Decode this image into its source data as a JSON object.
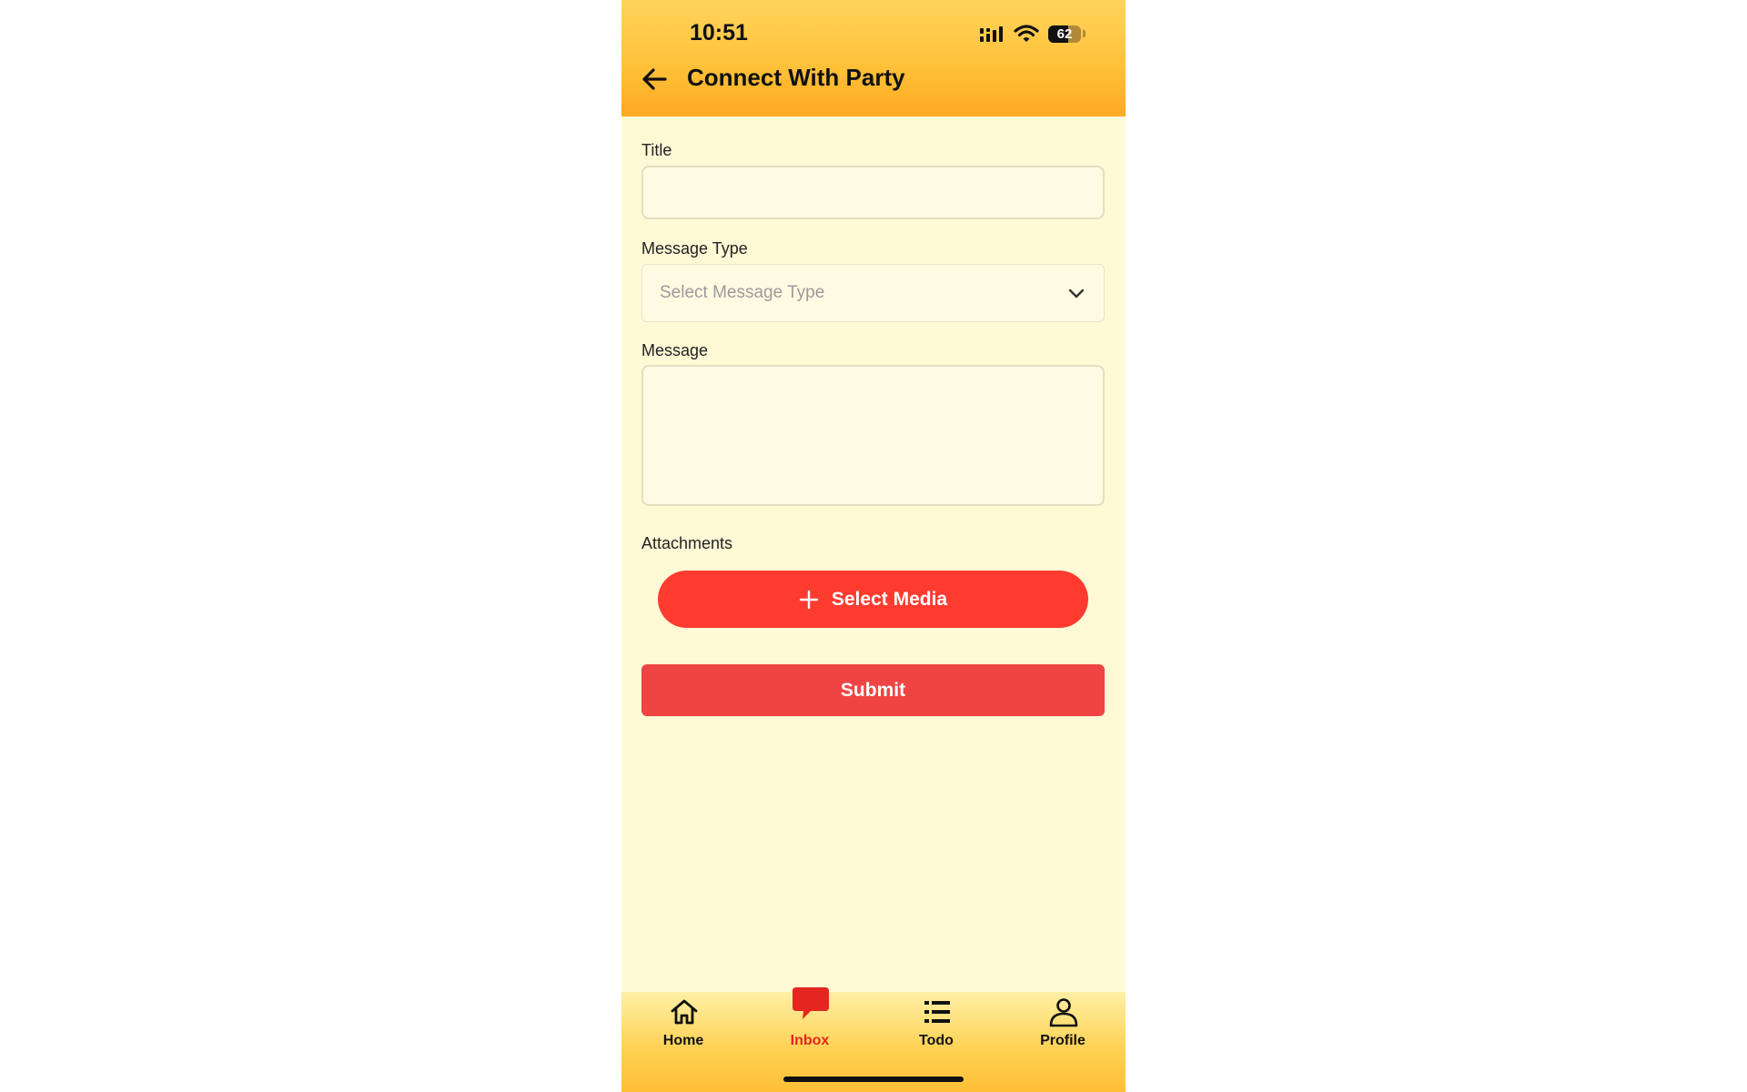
{
  "status_bar": {
    "time": "10:51",
    "battery_percent": "62"
  },
  "header": {
    "title": "Connect With Party"
  },
  "form": {
    "title_label": "Title",
    "title_value": "",
    "message_type_label": "Message Type",
    "message_type_placeholder": "Select Message Type",
    "message_label": "Message",
    "message_value": "",
    "attachments_label": "Attachments",
    "select_media_label": "Select Media",
    "submit_label": "Submit"
  },
  "bottom_nav": {
    "items": [
      {
        "label": "Home",
        "icon": "home-icon"
      },
      {
        "label": "Inbox",
        "icon": "chat-bubble-icon",
        "active": true
      },
      {
        "label": "Todo",
        "icon": "list-icon"
      },
      {
        "label": "Profile",
        "icon": "person-icon"
      }
    ]
  },
  "colors": {
    "background": "#fff9d6",
    "header_gradient_top": "#ffd45c",
    "header_gradient_bottom": "#ffaa22",
    "accent_red": "#ff3b30",
    "submit_red": "#ef4444",
    "active_nav": "#e5251f"
  }
}
